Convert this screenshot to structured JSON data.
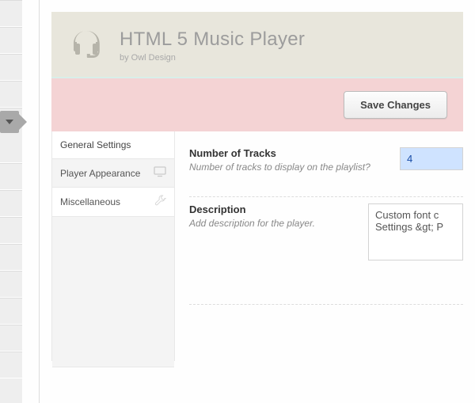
{
  "header": {
    "title": "HTML 5 Music Player",
    "byline": "by Owl Design"
  },
  "action": {
    "save_label": "Save Changes"
  },
  "sidebar": {
    "heading": "General Settings",
    "items": [
      {
        "label": "Player Appearance"
      },
      {
        "label": "Miscellaneous"
      }
    ]
  },
  "fields": {
    "tracks": {
      "title": "Number of Tracks",
      "help": "Number of tracks to display on the playlist?",
      "value": "4"
    },
    "description": {
      "title": "Description",
      "help": "Add description for the player.",
      "value": "Custom font c\nSettings &gt; P"
    }
  }
}
